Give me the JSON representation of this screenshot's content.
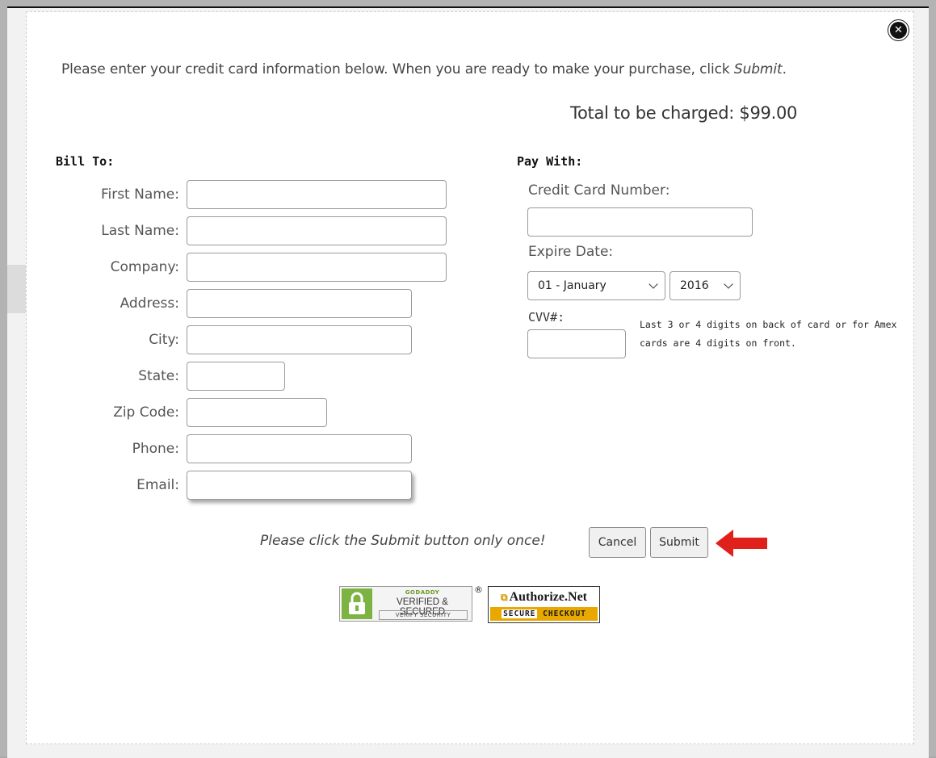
{
  "intro": {
    "text": "Please enter your credit card information below. When you are ready to make your purchase, click ",
    "emphasis": "Submit",
    "end": "."
  },
  "total": "Total to be charged: $99.00",
  "bill_to": {
    "heading": "Bill To:",
    "labels": {
      "first_name": "First Name:",
      "last_name": "Last Name:",
      "company": "Company:",
      "address": "Address:",
      "city": "City:",
      "state": "State:",
      "zip": "Zip Code:",
      "phone": "Phone:",
      "email": "Email:"
    },
    "values": {
      "first_name": "",
      "last_name": "",
      "company": "",
      "address": "",
      "city": "",
      "state": "",
      "zip": "",
      "phone": "",
      "email": ""
    }
  },
  "pay_with": {
    "heading": "Pay With:",
    "card_number_label": "Credit Card Number:",
    "card_number_value": "",
    "expire_label": "Expire Date:",
    "expire_month": "01 - January",
    "expire_year": "2016",
    "cvv_label": "CVV#:",
    "cvv_value": "",
    "cvv_help": "Last 3 or 4 digits on back of card or for Amex cards are 4 digits on front."
  },
  "footer": {
    "note": "Please click the Submit button only once!",
    "cancel_label": "Cancel",
    "submit_label": "Submit"
  },
  "badges": {
    "godaddy_top": "GODADDY",
    "godaddy_mid": "VERIFIED & SECURED",
    "godaddy_bot": "VERIFY SECURITY",
    "registered": "®",
    "authnet_name": "Authorize.Net",
    "authnet_secure": "SECURE",
    "authnet_checkout": "CHECKOUT"
  },
  "colors": {
    "arrow": "#e0201a",
    "godaddy_green": "#7cb342",
    "authnet_gold": "#e8a800"
  },
  "icons": {
    "close": "close-x-icon",
    "arrow": "red-arrow-left-icon",
    "lock": "padlock-icon"
  }
}
